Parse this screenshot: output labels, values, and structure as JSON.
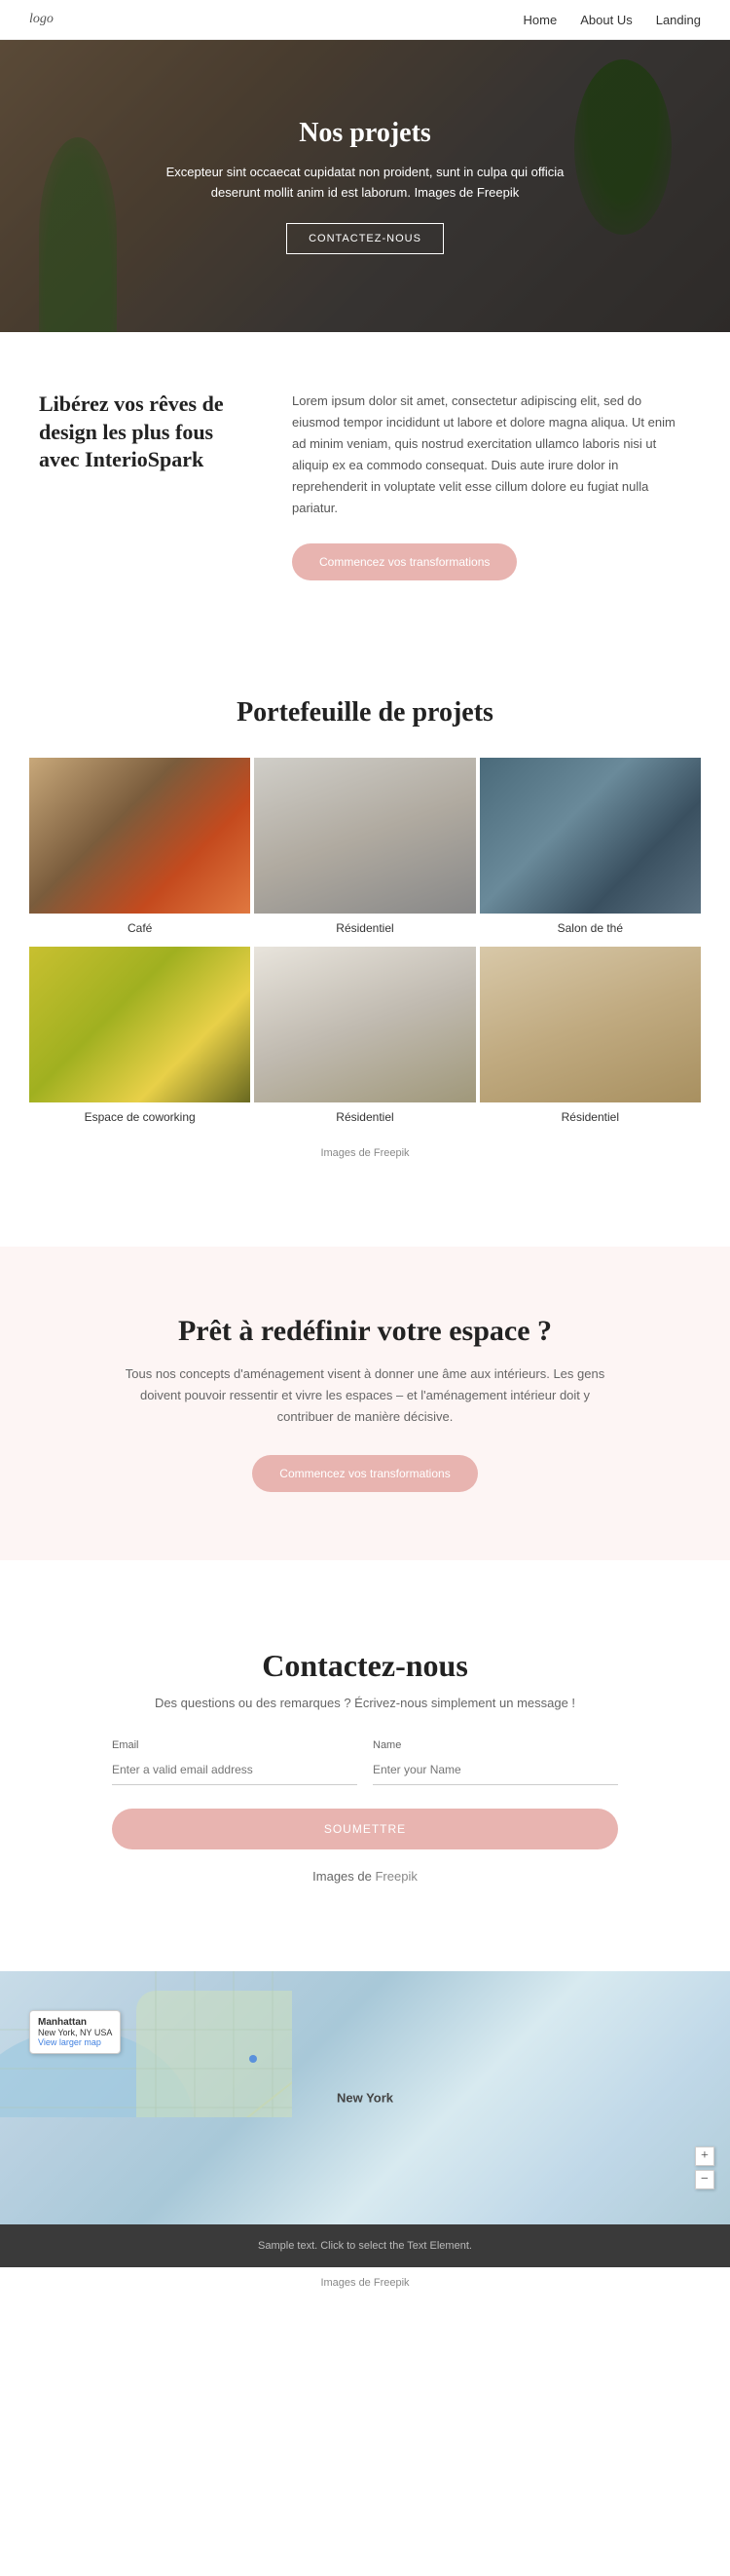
{
  "nav": {
    "logo": "logo",
    "links": [
      {
        "label": "Home",
        "href": "#"
      },
      {
        "label": "About Us",
        "href": "#"
      },
      {
        "label": "Landing",
        "href": "#"
      }
    ]
  },
  "hero": {
    "title": "Nos projets",
    "subtitle": "Excepteur sint occaecat cupidatat non proident, sunt in culpa qui officia deserunt mollit anim id est laborum. Images de Freepik",
    "subtitle_link": "Freepik",
    "cta": "CONTACTEZ-NOUS"
  },
  "liberez": {
    "heading": "Libérez vos rêves de design les plus fous avec InterioSpark",
    "body": "Lorem ipsum dolor sit amet, consectetur adipiscing elit, sed do eiusmod tempor incididunt ut labore et dolore magna aliqua. Ut enim ad minim veniam, quis nostrud exercitation ullamco laboris nisi ut aliquip ex ea commodo consequat. Duis aute irure dolor in reprehenderit in voluptate velit esse cillum dolore eu fugiat nulla pariatur.",
    "cta": "Commencez vos transformations"
  },
  "portfolio": {
    "heading": "Portefeuille de projets",
    "items": [
      {
        "label": "Café",
        "img_class": "img-cafe"
      },
      {
        "label": "Résidentiel",
        "img_class": "img-resid1"
      },
      {
        "label": "Salon de thé",
        "img_class": "img-salon"
      },
      {
        "label": "Espace de coworking",
        "img_class": "img-cowork"
      },
      {
        "label": "Résidentiel",
        "img_class": "img-resid2"
      },
      {
        "label": "Résidentiel",
        "img_class": "img-resid3"
      }
    ],
    "credit": "Images de Freepik"
  },
  "pret": {
    "heading": "Prêt à redéfinir votre espace ?",
    "body": "Tous nos concepts d'aménagement visent à donner une âme aux intérieurs. Les gens doivent pouvoir ressentir et vivre les espaces – et l'aménagement intérieur doit y contribuer de manière décisive.",
    "cta": "Commencez vos transformations"
  },
  "contact": {
    "heading": "Contactez-nous",
    "subtitle": "Des questions ou des remarques ? Écrivez-nous simplement un message !",
    "email_label": "Email",
    "email_placeholder": "Enter a valid email address",
    "name_label": "Name",
    "name_placeholder": "Enter your Name",
    "submit": "SOUMETTRE",
    "credit": "Images de Freepik"
  },
  "map": {
    "label": "New York",
    "marker_title": "Manhattan",
    "marker_address": "New York, NY USA",
    "marker_link": "View larger map",
    "plus": "+",
    "minus": "−"
  },
  "footer": {
    "text": "Sample text. Click to select the Text Element.",
    "credit": "Images de Freepik"
  }
}
